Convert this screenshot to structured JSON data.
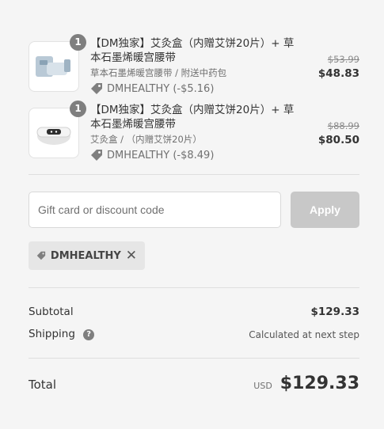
{
  "line_items": [
    {
      "quantity": "1",
      "title": "【DM独家】艾灸盒（内赠艾饼20片）+ 草本石墨烯暖宫腰带",
      "variant": "草本石墨烯暖宫腰带 / 附送中药包",
      "discount": "DMHEALTHY (-$5.16)",
      "price_original": "$53.99",
      "price_final": "$48.83",
      "thumb_icon": "belt-product-icon"
    },
    {
      "quantity": "1",
      "title": "【DM独家】艾灸盒（内赠艾饼20片）+ 草本石墨烯暖宫腰带",
      "variant": "艾灸盒 / （内赠艾饼20片）",
      "discount": "DMHEALTHY (-$8.49)",
      "price_original": "$88.99",
      "price_final": "$80.50",
      "thumb_icon": "moxibustion-box-icon"
    }
  ],
  "discount_form": {
    "placeholder": "Gift card or discount code",
    "value": "",
    "apply_label": "Apply"
  },
  "applied_discount": {
    "code": "DMHEALTHY"
  },
  "summary": {
    "subtotal_label": "Subtotal",
    "subtotal_value": "$129.33",
    "shipping_label": "Shipping",
    "shipping_value": "Calculated at next step",
    "total_label": "Total",
    "currency": "USD",
    "total_value": "$129.33"
  },
  "colors": {
    "background": "#f5f5f5",
    "badge": "#7f7f7f",
    "apply_disabled": "#c8c8c8",
    "chip": "#e6e6e6"
  }
}
